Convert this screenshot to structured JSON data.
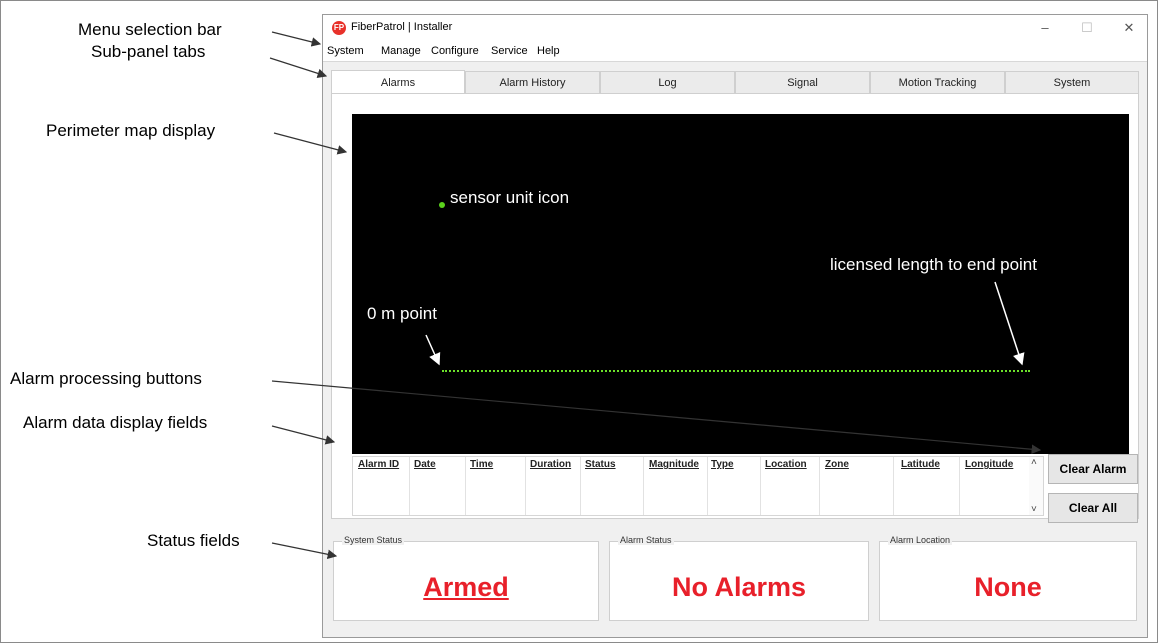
{
  "annotations": {
    "menu_selection_bar": "Menu selection bar",
    "sub_panel_tabs": "Sub-panel tabs",
    "perimeter_map_display": "Perimeter map display",
    "alarm_processing_buttons": "Alarm processing buttons",
    "alarm_data_display_fields": "Alarm data display fields",
    "status_fields": "Status fields"
  },
  "window": {
    "title": "FiberPatrol | Installer",
    "logo_text": "FP",
    "controls": {
      "minimize": "–",
      "maximize": "☐",
      "close": "✕"
    }
  },
  "menu": [
    "System",
    "Manage",
    "Configure",
    "Service",
    "Help"
  ],
  "tabs": [
    "Alarms",
    "Alarm History",
    "Log",
    "Signal",
    "Motion Tracking",
    "System"
  ],
  "active_tab": "Alarms",
  "map": {
    "sensor_label": "sensor unit icon",
    "zero_point_label": "0 m point",
    "end_point_label": "licensed length to end point",
    "line_color": "#6ce02a",
    "sensor_color": "#5bd21c"
  },
  "alarm_table": {
    "columns": [
      "Alarm ID",
      "Date",
      "Time",
      "Duration",
      "Status",
      "Magnitude",
      "Type",
      "Location",
      "Zone",
      "Latitude",
      "Longitude"
    ],
    "scroll_up": "˄",
    "scroll_down": "˅"
  },
  "buttons": {
    "clear_alarm": "Clear Alarm",
    "clear_all": "Clear All"
  },
  "status": {
    "system": {
      "caption": "System Status",
      "value": "Armed"
    },
    "alarm": {
      "caption": "Alarm Status",
      "value": "No Alarms"
    },
    "location": {
      "caption": "Alarm Location",
      "value": "None"
    }
  },
  "colors": {
    "status_red": "#e8202a",
    "map_bg": "#000000",
    "logo_red": "#e8312a"
  }
}
